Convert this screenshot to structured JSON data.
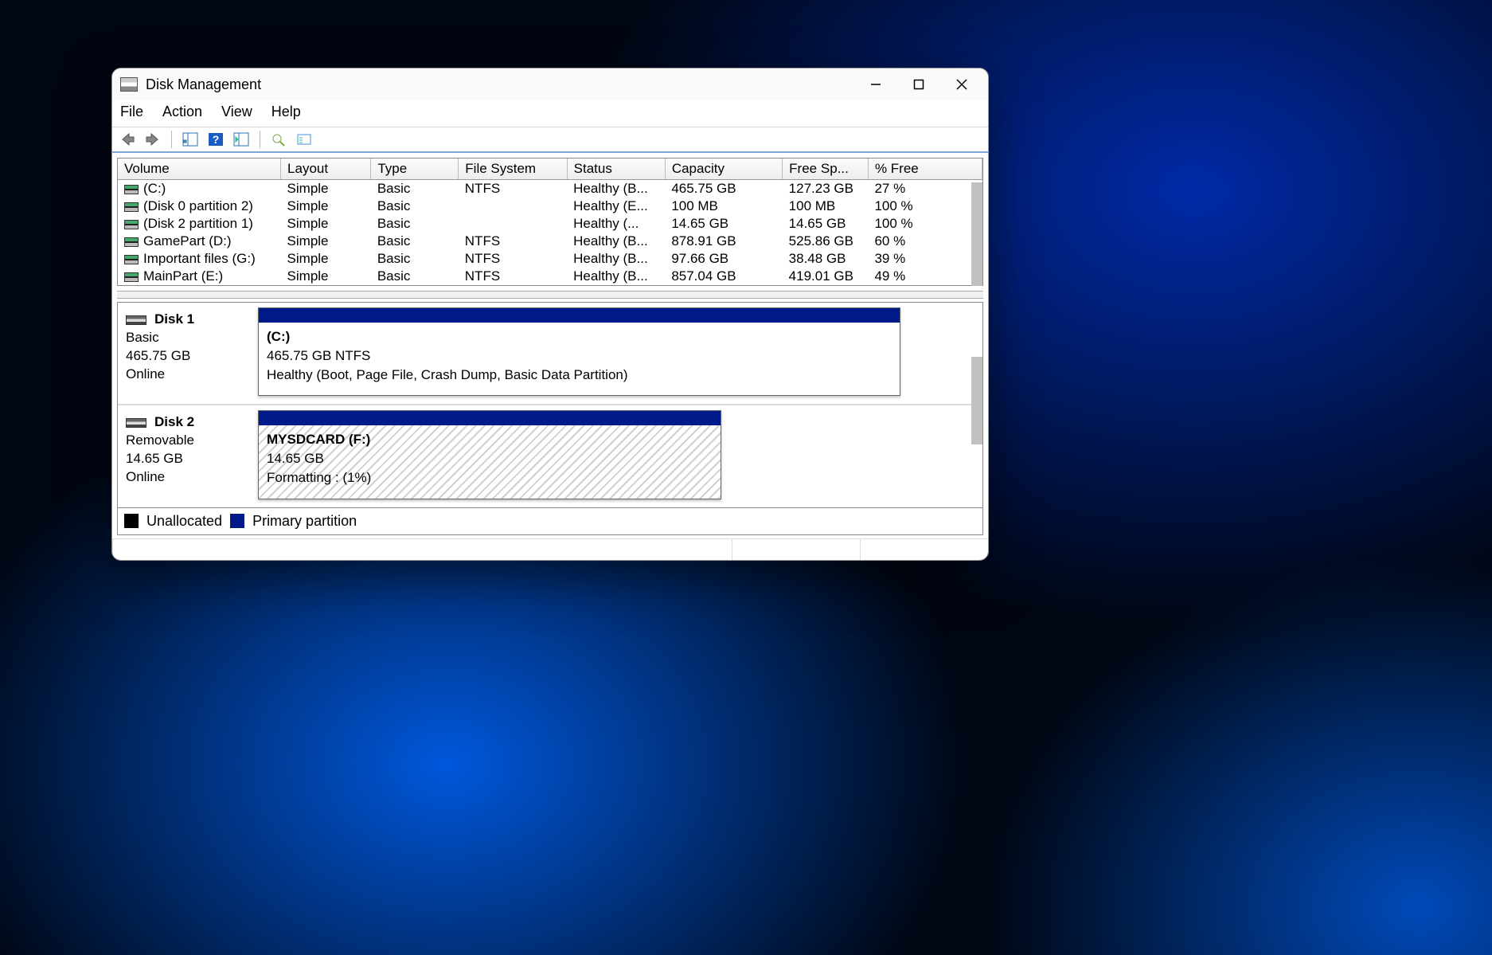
{
  "window": {
    "title": "Disk Management"
  },
  "menu": {
    "file": "File",
    "action": "Action",
    "view": "View",
    "help": "Help"
  },
  "columns": {
    "volume": "Volume",
    "layout": "Layout",
    "type": "Type",
    "fs": "File System",
    "status": "Status",
    "capacity": "Capacity",
    "free": "Free Sp...",
    "pct": "% Free"
  },
  "rows": [
    {
      "volume": "(C:)",
      "layout": "Simple",
      "type": "Basic",
      "fs": "NTFS",
      "status": "Healthy (B...",
      "capacity": "465.75 GB",
      "free": "127.23 GB",
      "pct": "27 %"
    },
    {
      "volume": "(Disk 0 partition 2)",
      "layout": "Simple",
      "type": "Basic",
      "fs": "",
      "status": "Healthy (E...",
      "capacity": "100 MB",
      "free": "100 MB",
      "pct": "100 %"
    },
    {
      "volume": "(Disk 2 partition 1)",
      "layout": "Simple",
      "type": "Basic",
      "fs": "",
      "status": "Healthy (...",
      "capacity": "14.65 GB",
      "free": "14.65 GB",
      "pct": "100 %"
    },
    {
      "volume": "GamePart (D:)",
      "layout": "Simple",
      "type": "Basic",
      "fs": "NTFS",
      "status": "Healthy (B...",
      "capacity": "878.91 GB",
      "free": "525.86 GB",
      "pct": "60 %"
    },
    {
      "volume": "Important files (G:)",
      "layout": "Simple",
      "type": "Basic",
      "fs": "NTFS",
      "status": "Healthy (B...",
      "capacity": "97.66 GB",
      "free": "38.48 GB",
      "pct": "39 %"
    },
    {
      "volume": "MainPart (E:)",
      "layout": "Simple",
      "type": "Basic",
      "fs": "NTFS",
      "status": "Healthy (B...",
      "capacity": "857.04 GB",
      "free": "419.01 GB",
      "pct": "49 %"
    }
  ],
  "disk1": {
    "name": "Disk 1",
    "l1": "Basic",
    "l2": "465.75 GB",
    "l3": "Online",
    "part_name": "(C:)",
    "part_size": "465.75 GB NTFS",
    "part_status": "Healthy (Boot, Page File, Crash Dump, Basic Data Partition)"
  },
  "disk2": {
    "name": "Disk 2",
    "l1": "Removable",
    "l2": "14.65 GB",
    "l3": "Online",
    "part_name": "MYSDCARD  (F:)",
    "part_size": "14.65 GB",
    "part_status": "Formatting : (1%)"
  },
  "legend": {
    "unalloc": "Unallocated",
    "primary": "Primary partition"
  }
}
